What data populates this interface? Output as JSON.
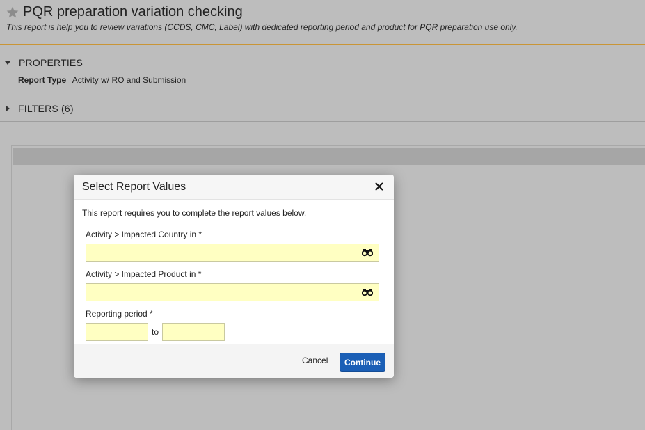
{
  "header": {
    "title": "PQR preparation variation checking",
    "subtitle": "This report is help you to review variations (CCDS, CMC, Label) with dedicated reporting period and product for PQR preparation use only.",
    "star_icon": "star-icon"
  },
  "properties": {
    "label": "PROPERTIES",
    "report_type_key": "Report Type",
    "report_type_value": "Activity w/ RO and Submission"
  },
  "filters": {
    "label": "FILTERS (6)"
  },
  "modal": {
    "title": "Select Report Values",
    "intro": "This report requires you to complete the report values below.",
    "fields": [
      {
        "label": "Activity > Impacted Country in *",
        "value": "",
        "icon": "binoculars-icon"
      },
      {
        "label": "Activity > Impacted Product in *",
        "value": "",
        "icon": "binoculars-icon"
      }
    ],
    "period": {
      "label": "Reporting period *",
      "from_value": "",
      "to_label": "to",
      "to_value": ""
    },
    "cancel_label": "Cancel",
    "continue_label": "Continue"
  },
  "colors": {
    "accent": "#c99536",
    "primary_button": "#1b5fb6",
    "required_field": "#ffffc2",
    "overlay_background": "#bdbdbd"
  }
}
